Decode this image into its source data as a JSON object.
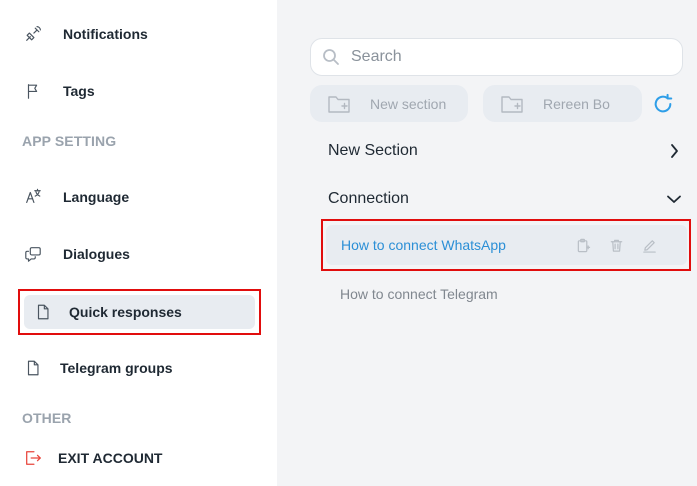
{
  "sidebar": {
    "items_top": [
      {
        "label": "Notifications",
        "icon": "satellite-icon"
      },
      {
        "label": "Tags",
        "icon": "flag-icon"
      }
    ],
    "section_app": "APP SETTING",
    "items_app": [
      {
        "label": "Language",
        "icon": "translate-icon"
      },
      {
        "label": "Dialogues",
        "icon": "chat-icon"
      },
      {
        "label": "Quick responses",
        "icon": "document-icon",
        "active": true
      },
      {
        "label": "Telegram groups",
        "icon": "document-icon"
      }
    ],
    "section_other": "OTHER",
    "exit_label": "EXIT ACCOUNT"
  },
  "main": {
    "search": {
      "placeholder": "Search",
      "value": ""
    },
    "buttons": {
      "new_section": "New section",
      "second": "Rereen Bo"
    },
    "groups": [
      {
        "label": "New Section",
        "expanded": false
      },
      {
        "label": "Connection",
        "expanded": true
      }
    ],
    "questions": [
      {
        "label": "How to connect WhatsApp",
        "active": true
      },
      {
        "label": "How to connect Telegram",
        "active": false
      }
    ]
  },
  "colors": {
    "accent_blue": "#2e9ee8",
    "link_blue": "#2b8fd6",
    "highlight_red": "#e10d0d",
    "exit_red": "#e8463c",
    "active_bg": "#e8ecf1"
  }
}
